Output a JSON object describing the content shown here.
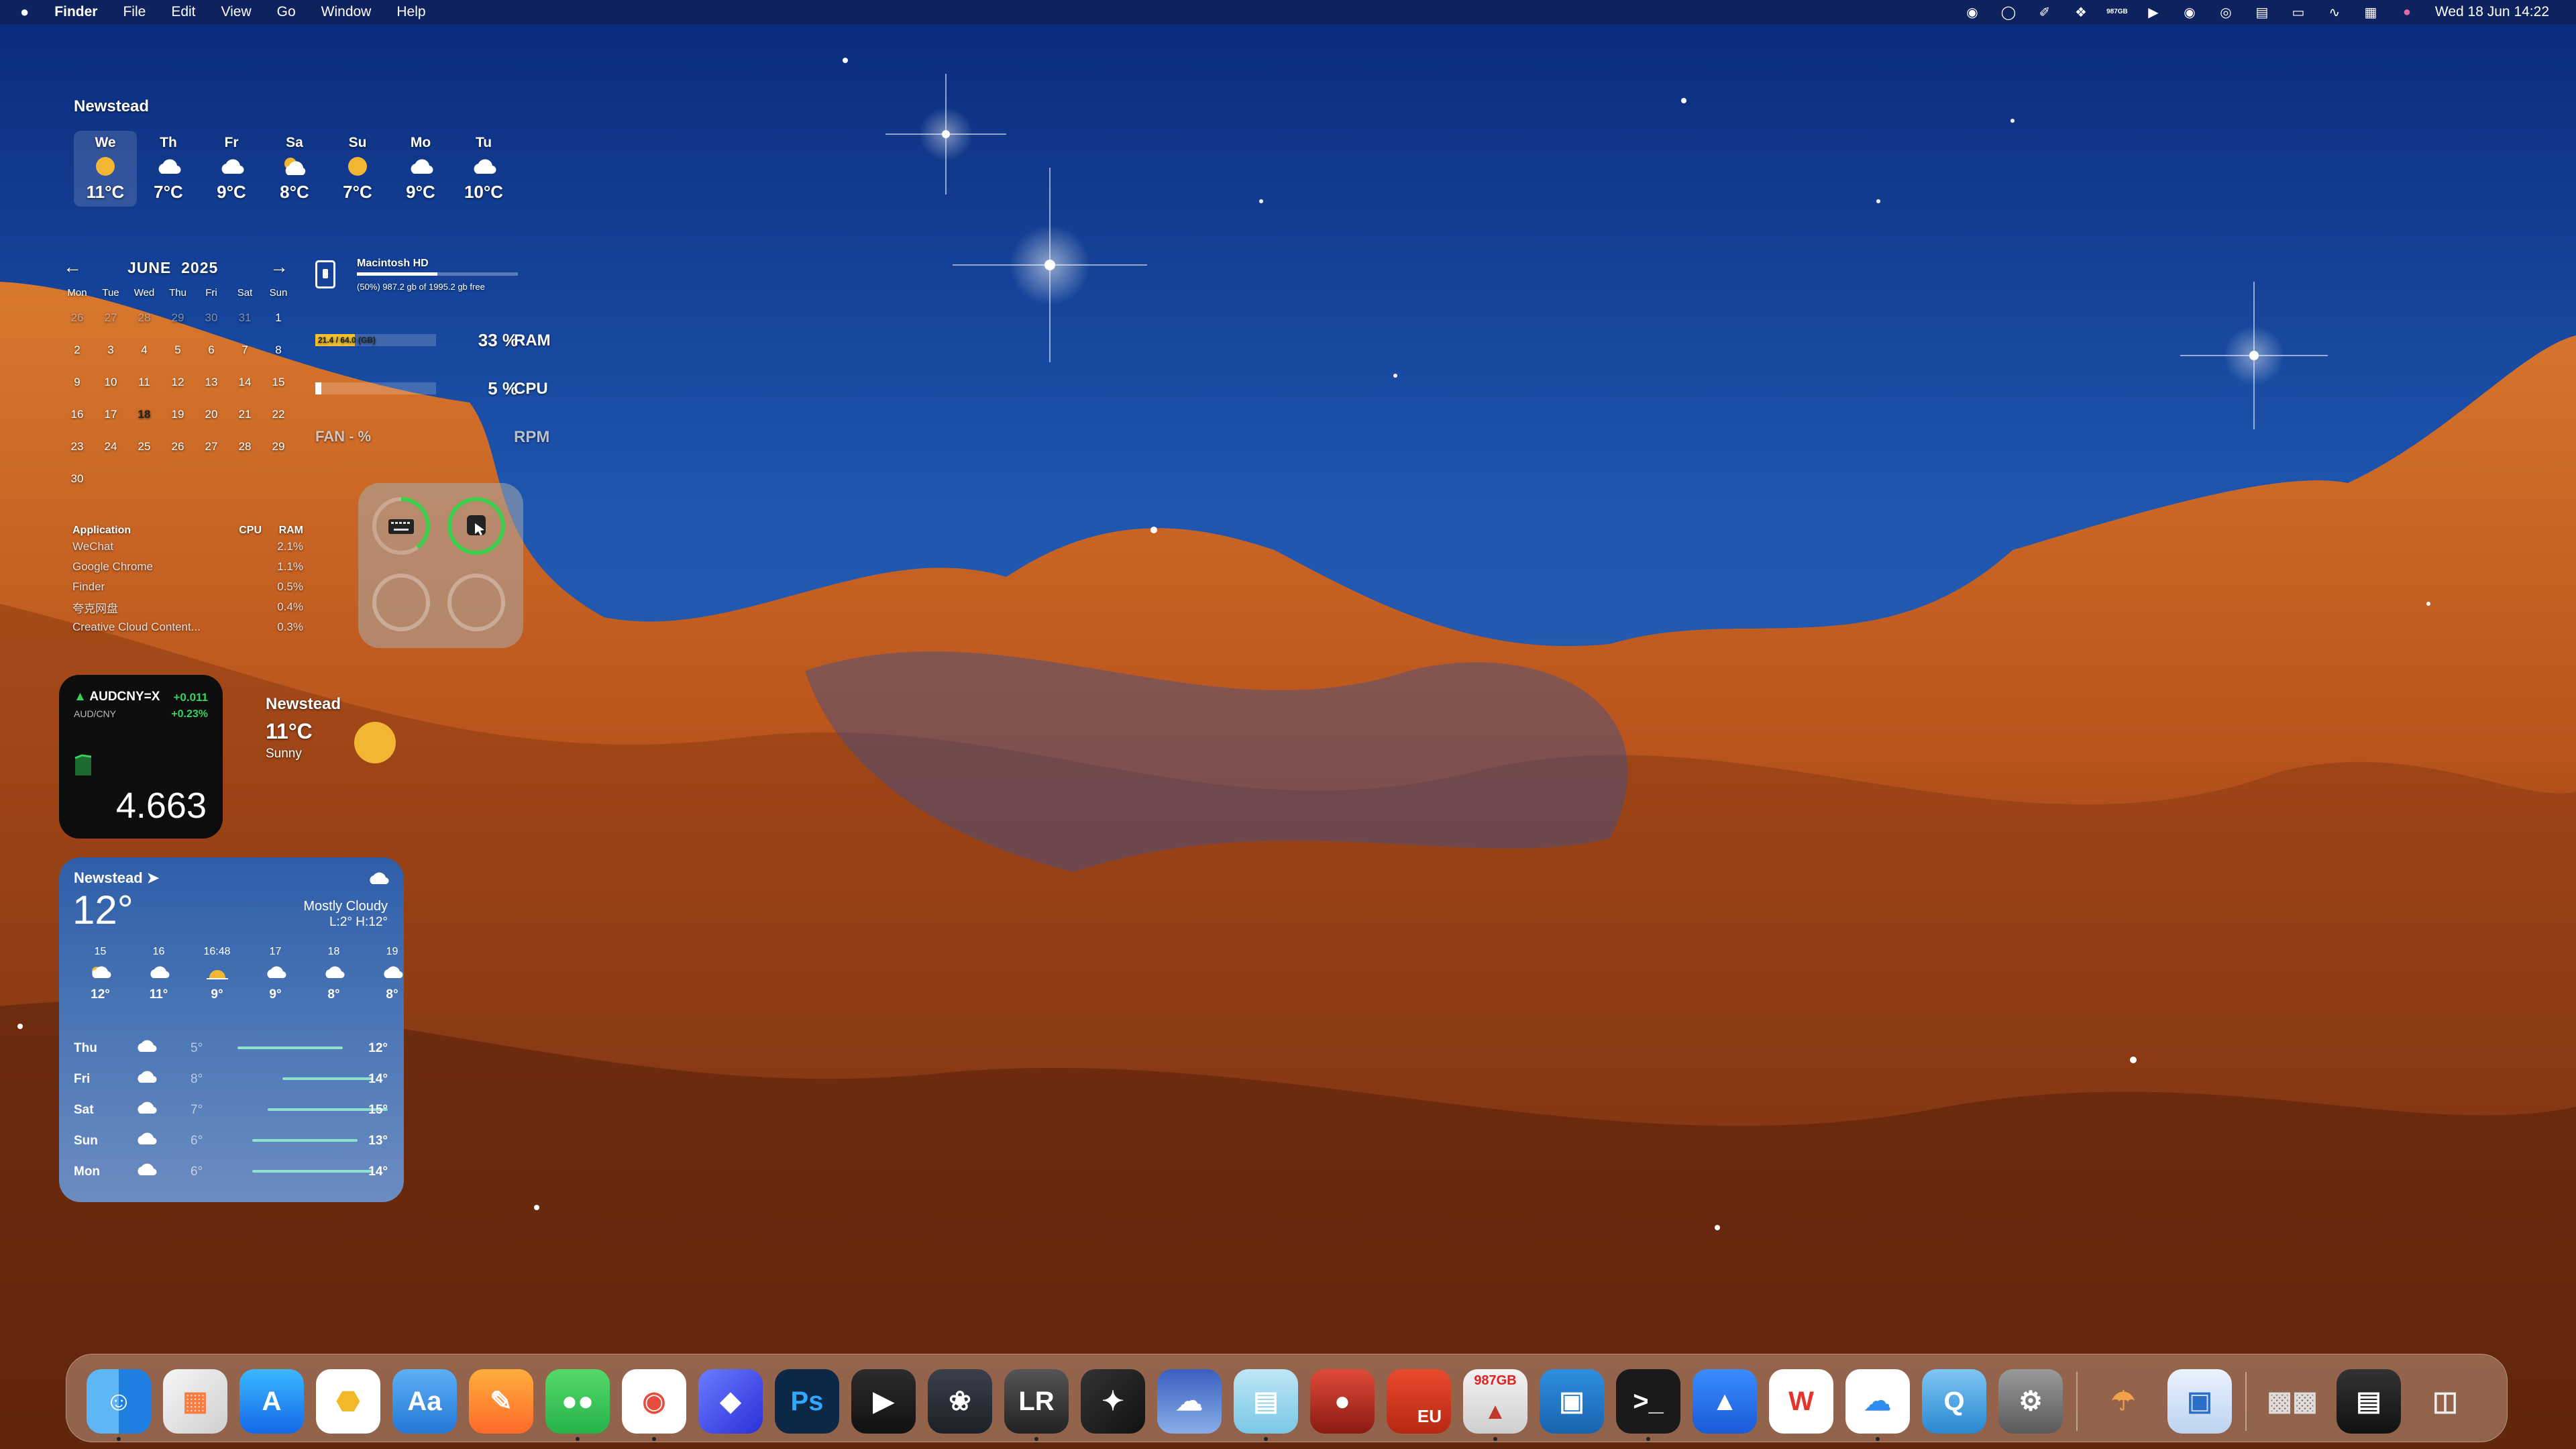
{
  "menubar": {
    "apple": "",
    "app": "Finder",
    "menus": [
      "File",
      "Edit",
      "View",
      "Go",
      "Window",
      "Help"
    ],
    "disk_mini_top": "987",
    "disk_mini_bottom": "GB",
    "datetime": "Wed 18 Jun  14:22"
  },
  "forecast": {
    "location": "Newstead",
    "days": [
      {
        "d": "We",
        "t": "11°C",
        "icon": "sun-icon"
      },
      {
        "d": "Th",
        "t": "7°C",
        "icon": "cloud-icon"
      },
      {
        "d": "Fr",
        "t": "9°C",
        "icon": "cloud-icon"
      },
      {
        "d": "Sa",
        "t": "8°C",
        "icon": "partly-cloudy-icon"
      },
      {
        "d": "Su",
        "t": "7°C",
        "icon": "sun-icon"
      },
      {
        "d": "Mo",
        "t": "9°C",
        "icon": "cloud-icon"
      },
      {
        "d": "Tu",
        "t": "10°C",
        "icon": "cloud-icon"
      }
    ]
  },
  "calendar": {
    "month": "JUNE",
    "year": "2025",
    "weekdays": [
      "Mon",
      "Tue",
      "Wed",
      "Thu",
      "Fri",
      "Sat",
      "Sun"
    ],
    "cells": [
      "26",
      "27",
      "28",
      "29",
      "30",
      "31",
      "1",
      "2",
      "3",
      "4",
      "5",
      "6",
      "7",
      "8",
      "9",
      "10",
      "11",
      "12",
      "13",
      "14",
      "15",
      "16",
      "17",
      "18",
      "19",
      "20",
      "21",
      "22",
      "23",
      "24",
      "25",
      "26",
      "27",
      "28",
      "29",
      "30"
    ],
    "leading_muted": 6,
    "today": "18"
  },
  "disk": {
    "name": "Macintosh HD",
    "free_text": "(50%) 987.2 gb of 1995.2 gb free",
    "used_fraction": 0.5
  },
  "ram": {
    "bar_text": "21.4 / 64.0 (GB)",
    "value": "33 %",
    "label": "RAM",
    "fraction": 0.33
  },
  "cpu": {
    "value": "5 %",
    "label": "CPU",
    "fraction": 0.05
  },
  "fan": {
    "value": "FAN - %",
    "label": "RPM"
  },
  "processes": {
    "headers": [
      "Application",
      "CPU",
      "RAM"
    ],
    "rows": [
      {
        "name": "WeChat",
        "cpu": "",
        "ram": "2.1%"
      },
      {
        "name": "Google Chrome",
        "cpu": "",
        "ram": "1.1%"
      },
      {
        "name": "Finder",
        "cpu": "",
        "ram": "0.5%"
      },
      {
        "name": "夸克网盘",
        "cpu": "",
        "ram": "0.4%"
      },
      {
        "name": "Creative Cloud Content...",
        "cpu": "",
        "ram": "0.3%"
      }
    ]
  },
  "shortcuts": {
    "items": [
      {
        "icon": "keyboard-icon"
      },
      {
        "icon": "mouse-icon"
      },
      {
        "icon": "empty-slot-icon"
      },
      {
        "icon": "empty-slot-icon"
      }
    ]
  },
  "stock": {
    "symbol": "AUDCNY=X",
    "change": "+0.011",
    "pair": "AUD/CNY",
    "percent": "+0.23%",
    "price": "4.663"
  },
  "weather_small": {
    "location": "Newstead",
    "temp": "11°C",
    "condition": "Sunny"
  },
  "weather": {
    "location": "Newstead",
    "temp": "12°",
    "condition": "Mostly Cloudy",
    "lowhigh": "L:2° H:12°",
    "hours": [
      {
        "t": "15",
        "v": "12°",
        "icon": "partly-sunny-icon"
      },
      {
        "t": "16",
        "v": "11°",
        "icon": "cloud-icon"
      },
      {
        "t": "16:48",
        "v": "9°",
        "icon": "sunset-icon"
      },
      {
        "t": "17",
        "v": "9°",
        "icon": "cloud-icon"
      },
      {
        "t": "18",
        "v": "8°",
        "icon": "cloud-icon"
      },
      {
        "t": "19",
        "v": "8°",
        "icon": "cloud-icon"
      }
    ],
    "days": [
      {
        "d": "Thu",
        "lo": "5°",
        "hi": "12°",
        "icon": "cloud-icon"
      },
      {
        "d": "Fri",
        "lo": "8°",
        "hi": "14°",
        "icon": "cloud-icon"
      },
      {
        "d": "Sat",
        "lo": "7°",
        "hi": "15°",
        "icon": "cloud-icon"
      },
      {
        "d": "Sun",
        "lo": "6°",
        "hi": "13°",
        "icon": "cloud-icon"
      },
      {
        "d": "Mon",
        "lo": "6°",
        "hi": "14°",
        "icon": "cloud-icon"
      }
    ]
  },
  "dock": {
    "disk_badge": "987GB",
    "eu_label": "EU",
    "ps_label": "Ps",
    "app_labels": [
      "finder-icon",
      "launchpad-icon",
      "app-store-icon",
      "hexagon-app-icon",
      "dictionary-icon",
      "pages-icon",
      "wechat-icon",
      "chrome-icon",
      "crystal-app-icon",
      "photoshop-icon",
      "final-cut-icon",
      "davinci-resolve-icon",
      "lrtimelapse-icon",
      "instruments-icon",
      "weather-scene-icon",
      "stack-app-icon",
      "red-app-icon",
      "office-eu-icon",
      "disk-monitor-icon",
      "frame-app-icon",
      "terminal-icon",
      "cloud-arrow-icon",
      "wps-icon",
      "cloud-drive-icon",
      "quicktime-icon",
      "system-settings-icon",
      "umbrella-app-icon",
      "preview-icon",
      "keyboard-dock-icon",
      "photo-stack-icon",
      "trash-icon"
    ]
  }
}
